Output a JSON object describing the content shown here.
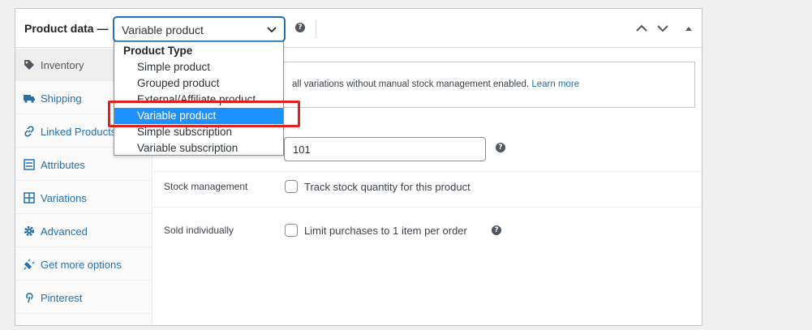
{
  "header": {
    "title": "Product data —",
    "product_type_value": "Variable product"
  },
  "tabs": [
    {
      "label": "Inventory",
      "icon": "tag-icon",
      "active": true
    },
    {
      "label": "Shipping",
      "icon": "truck-icon"
    },
    {
      "label": "Linked Products",
      "icon": "link-icon"
    },
    {
      "label": "Attributes",
      "icon": "list-icon"
    },
    {
      "label": "Variations",
      "icon": "grid-icon"
    },
    {
      "label": "Advanced",
      "icon": "gear-icon"
    },
    {
      "label": "Get more options",
      "icon": "plugin-icon"
    },
    {
      "label": "Pinterest",
      "icon": "pinterest-icon"
    }
  ],
  "dropdown": {
    "group_label": "Product Type",
    "options": [
      "Simple product",
      "Grouped product",
      "External/Affiliate product",
      "Variable product",
      "Simple subscription",
      "Variable subscription"
    ],
    "selected": "Variable product"
  },
  "inventory": {
    "notice_text": "all variations without manual stock management enabled.",
    "notice_link": "Learn more",
    "sku_value": "101",
    "stock_label": "Stock management",
    "stock_checkbox_label": "Track stock quantity for this product",
    "sold_label": "Sold individually",
    "sold_checkbox_label": "Limit purchases to 1 item per order"
  },
  "colors": {
    "accent": "#2271b1",
    "selected_option": "#1e90ff",
    "highlight": "#e3201b"
  }
}
